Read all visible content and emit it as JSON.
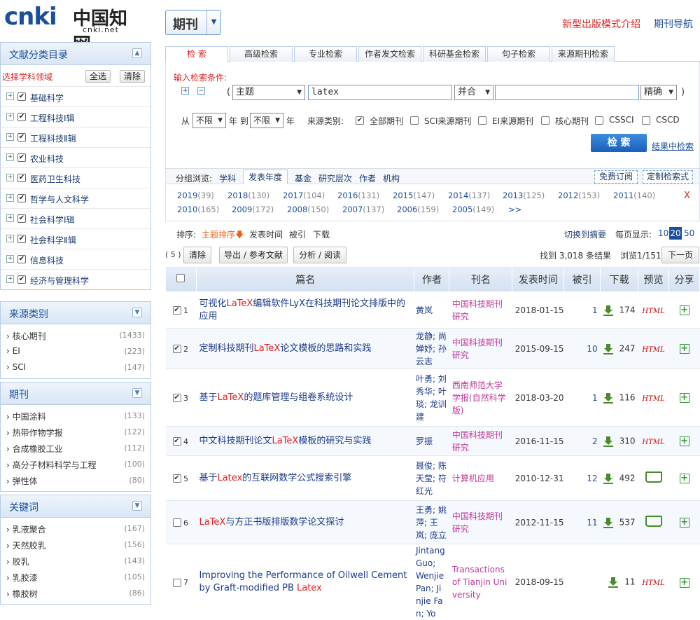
{
  "header": {
    "logo_text": "cnki",
    "logo_cn": "中国知网",
    "logo_url": "cnki.net",
    "db_select": "期刊",
    "links": [
      "新型出版模式介绍",
      "期刊导航"
    ]
  },
  "sidebar": {
    "catalog": {
      "title": "文献分类目录",
      "choose_label": "选择学科领域",
      "select_all": "全选",
      "clear": "清除",
      "items": [
        "基础科学",
        "工程科技Ⅰ辑",
        "工程科技Ⅱ辑",
        "农业科技",
        "医药卫生科技",
        "哲学与人文科学",
        "社会科学Ⅰ辑",
        "社会科学Ⅱ辑",
        "信息科技",
        "经济与管理科学"
      ]
    },
    "source": {
      "title": "来源类别",
      "items": [
        {
          "label": "核心期刊",
          "count": "(1433)"
        },
        {
          "label": "EI",
          "count": "(223)"
        },
        {
          "label": "SCI",
          "count": "(147)"
        }
      ]
    },
    "journal": {
      "title": "期刊",
      "items": [
        {
          "label": "中国涂料",
          "count": "(133)"
        },
        {
          "label": "热带作物学报",
          "count": "(122)"
        },
        {
          "label": "合成橡胶工业",
          "count": "(112)"
        },
        {
          "label": "高分子材料科学与工程",
          "count": "(100)"
        },
        {
          "label": "弹性体",
          "count": "(80)"
        }
      ]
    },
    "keyword": {
      "title": "关键词",
      "items": [
        {
          "label": "乳液聚合",
          "count": "(167)"
        },
        {
          "label": "天然胶乳",
          "count": "(156)"
        },
        {
          "label": "胶乳",
          "count": "(143)"
        },
        {
          "label": "乳胶漆",
          "count": "(105)"
        },
        {
          "label": "橡胶树",
          "count": "(86)"
        }
      ]
    }
  },
  "search": {
    "tabs": [
      "检 索",
      "高级检索",
      "专业检索",
      "作者发文检索",
      "科研基金检索",
      "句子检索",
      "来源期刊检索"
    ],
    "condition_label": "输入检索条件:",
    "field": "主题",
    "value": "latex",
    "logic": "并合",
    "match": "精确",
    "from_label": "从",
    "from_value": "不限",
    "year_label": "年 到",
    "to_value": "不限",
    "year2_label": "年",
    "source_label": "来源类别:",
    "sources": [
      "全部期刊",
      "SCI来源期刊",
      "EI来源期刊",
      "核心期刊",
      "CSSCI",
      "CSCD"
    ],
    "search_btn": "检 索",
    "in_result": "结果中检索"
  },
  "grouping": {
    "label": "分组浏览:",
    "options": [
      "学科",
      "发表年度",
      "基金",
      "研究层次",
      "作者",
      "机构"
    ],
    "free_sub": "免费订阅",
    "custom": "定制检索式",
    "close": "X",
    "years_row1": [
      {
        "y": "2019",
        "c": "(39)"
      },
      {
        "y": "2018",
        "c": "(130)"
      },
      {
        "y": "2017",
        "c": "(104)"
      },
      {
        "y": "2016",
        "c": "(131)"
      },
      {
        "y": "2015",
        "c": "(147)"
      },
      {
        "y": "2014",
        "c": "(137)"
      },
      {
        "y": "2013",
        "c": "(125)"
      },
      {
        "y": "2012",
        "c": "(153)"
      },
      {
        "y": "2011",
        "c": "(140)"
      }
    ],
    "years_row2": [
      {
        "y": "2010",
        "c": "(165)"
      },
      {
        "y": "2009",
        "c": "(172)"
      },
      {
        "y": "2008",
        "c": "(150)"
      },
      {
        "y": "2007",
        "c": "(137)"
      },
      {
        "y": "2006",
        "c": "(159)"
      },
      {
        "y": "2005",
        "c": "(149)"
      }
    ],
    "more": ">>"
  },
  "sort": {
    "label": "排序:",
    "options": [
      "主题排序",
      "发表时间",
      "被引",
      "下载"
    ],
    "switch": "切换到摘要",
    "per_page_label": "每页显示:",
    "per_page": [
      "10",
      "20",
      "50"
    ]
  },
  "controls": {
    "selected": "( 5 )",
    "clear": "清除",
    "export": "导出 / 参考文献",
    "analyze": "分析 / 阅读",
    "found": "找到 3,018 条结果",
    "browse": "浏览1/151",
    "next": "下一页"
  },
  "table": {
    "headers": [
      "篇名",
      "作者",
      "刊名",
      "发表时间",
      "被引",
      "下载",
      "预览",
      "分享"
    ],
    "rows": [
      {
        "n": "1",
        "checked": true,
        "pre": "可视化",
        "hl": "LaTeX",
        "post": "编辑软件LyX在科技期刊论文排版中的应用",
        "authors": "黄岚",
        "journal": "中国科技期刊研究",
        "date": "2018-01-15",
        "cited": "1",
        "dl": "174",
        "preview": "HTML"
      },
      {
        "n": "2",
        "checked": true,
        "pre": "定制科技期刊",
        "hl": "LaTeX",
        "post": "论文模板的思路和实践",
        "authors": "龙静; 尚婵妤; 孙云志",
        "journal": "中国科技期刊研究",
        "date": "2015-09-15",
        "cited": "10",
        "dl": "247",
        "preview": "HTML"
      },
      {
        "n": "3",
        "checked": true,
        "pre": "基于",
        "hl": "LaTeX",
        "post": "的题库管理与组卷系统设计",
        "authors": "叶勇; 刘秀华; 叶琰; 龙训建",
        "journal": "西南师范大学学报(自然科学版)",
        "date": "2018-03-20",
        "cited": "1",
        "dl": "116",
        "preview": "HTML"
      },
      {
        "n": "4",
        "checked": true,
        "pre": "中文科技期刊论文",
        "hl": "LaTeX",
        "post": "模板的研究与实践",
        "authors": "罗振",
        "journal": "中国科技期刊研究",
        "date": "2016-11-15",
        "cited": "2",
        "dl": "310",
        "preview": "HTML"
      },
      {
        "n": "5",
        "checked": true,
        "pre": "基于",
        "hl": "Latex",
        "post": "的互联网数学公式搜索引擎",
        "authors": "聂俊; 陈天莹; 符红光",
        "journal": "计算机应用",
        "date": "2010-12-31",
        "cited": "12",
        "dl": "492",
        "preview": "book"
      },
      {
        "n": "6",
        "checked": false,
        "pre": "",
        "hl": "LaTeX",
        "post": "与方正书版排版数学论文探讨",
        "authors": "王勇; 姚萍; 王岚; 庞立",
        "journal": "中国科技期刊研究",
        "date": "2012-11-15",
        "cited": "11",
        "dl": "537",
        "preview": "book"
      },
      {
        "n": "7",
        "checked": false,
        "pre": "Improving the Performance of Oilwell Cement by Graft-modified PB ",
        "hl": "Latex",
        "post": "",
        "authors": "Jintang Guo; Wenjie Pan; Jinjie Fan; Yo",
        "journal": "Transactions of Tianjin University",
        "date": "2018-09-15",
        "cited": "",
        "dl": "11",
        "preview": "HTML"
      }
    ]
  },
  "colors": {
    "accent": "#1b4f9c",
    "highlight": "#dd2222",
    "journal": "#c0389a"
  }
}
